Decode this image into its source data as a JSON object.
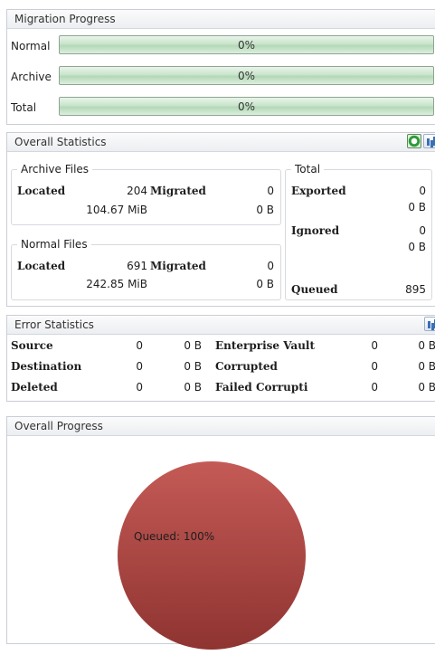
{
  "migration_progress": {
    "title": "Migration Progress",
    "rows": [
      {
        "label": "Normal",
        "percent_text": "0%",
        "fraction": 0
      },
      {
        "label": "Archive",
        "percent_text": "0%",
        "fraction": 0
      },
      {
        "label": "Total",
        "percent_text": "0%",
        "fraction": 0
      }
    ]
  },
  "overall_statistics": {
    "title": "Overall Statistics",
    "icons": [
      "refresh-icon",
      "chart-icon"
    ],
    "archive_files": {
      "title": "Archive Files",
      "located_label": "Located",
      "located_count": "204",
      "migrated_label": "Migrated",
      "migrated_count": "0",
      "located_size": "104.67 MiB",
      "migrated_size": "0 B"
    },
    "normal_files": {
      "title": "Normal Files",
      "located_label": "Located",
      "located_count": "691",
      "migrated_label": "Migrated",
      "migrated_count": "0",
      "located_size": "242.85 MiB",
      "migrated_size": "0 B"
    },
    "total": {
      "title": "Total",
      "exported_label": "Exported",
      "exported_count": "0",
      "exported_size": "0 B",
      "ignored_label": "Ignored",
      "ignored_count": "0",
      "ignored_size": "0 B",
      "queued_label": "Queued",
      "queued_count": "895"
    }
  },
  "error_statistics": {
    "title": "Error Statistics",
    "icons": [
      "chart-icon"
    ],
    "rows": [
      {
        "label": "Source",
        "count": "0",
        "size": "0 B",
        "label2": "Enterprise Vault",
        "count2": "0",
        "size2": "0 B"
      },
      {
        "label": "Destination",
        "count": "0",
        "size": "0 B",
        "label2": "Corrupted",
        "count2": "0",
        "size2": "0 B"
      },
      {
        "label": "Deleted",
        "count": "0",
        "size": "0 B",
        "label2": "Failed Corrupti",
        "count2": "0",
        "size2": "0 B"
      }
    ]
  },
  "overall_progress": {
    "title": "Overall Progress",
    "chart_data": {
      "type": "pie",
      "slices": [
        {
          "label": "Queued",
          "value": 100,
          "display": "Queued: 100%",
          "color": "#b44a47"
        }
      ]
    }
  }
}
